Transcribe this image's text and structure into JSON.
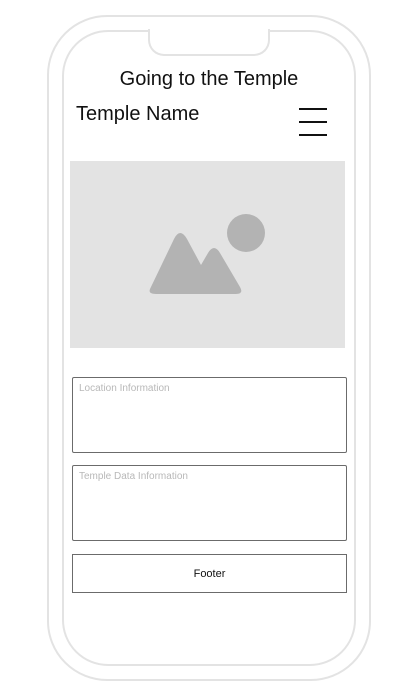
{
  "app": {
    "title": "Going to the Temple"
  },
  "header": {
    "temple_name": "Temple Name",
    "menu_icon": "hamburger-menu-icon"
  },
  "hero": {
    "icon": "image-placeholder-icon"
  },
  "location": {
    "placeholder": "Location Information"
  },
  "temple_data": {
    "placeholder": "Temple Data Information"
  },
  "footer": {
    "label": "Footer"
  },
  "colors": {
    "phone_frame": "#e3e3e3",
    "image_bg": "#e3e3e3",
    "image_glyph": "#b3b3b3",
    "box_border": "#6b6b6b",
    "placeholder_text": "#b8b8b8",
    "text": "#111111"
  }
}
